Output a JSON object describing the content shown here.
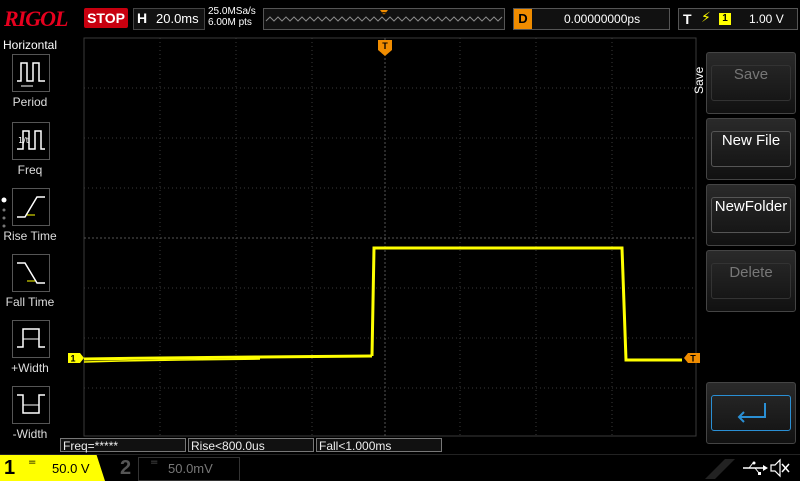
{
  "top": {
    "brand": "RIGOL",
    "run_state": "STOP",
    "horizontal_key": "H",
    "timebase": "20.0ms",
    "sample_rate": "25.0MSa/s",
    "memory_depth": "6.00M pts",
    "delay_key": "D",
    "delay_value": "0.00000000ps",
    "trigger_key": "T",
    "trigger_source": "1",
    "trigger_level": "1.00 V"
  },
  "left_panel": {
    "title": "Horizontal",
    "items": [
      {
        "label": "Period",
        "icon": "period-icon"
      },
      {
        "label": "Freq",
        "icon": "freq-icon"
      },
      {
        "label": "Rise Time",
        "icon": "rise-time-icon"
      },
      {
        "label": "Fall Time",
        "icon": "fall-time-icon"
      },
      {
        "label": "+Width",
        "icon": "positive-width-icon"
      },
      {
        "label": "-Width",
        "icon": "negative-width-icon"
      }
    ]
  },
  "right_menu": {
    "tab": "Save",
    "buttons": [
      {
        "label": "Save",
        "enabled": false
      },
      {
        "label": "New File",
        "enabled": true
      },
      {
        "label": "NewFolder",
        "enabled": true
      },
      {
        "label": "Delete",
        "enabled": false
      },
      {
        "label": "",
        "enabled": true,
        "icon": "enter-icon"
      }
    ]
  },
  "measurements": [
    "Freq=*****",
    "Rise<800.0us",
    "Fall<1.000ms"
  ],
  "channels": {
    "ch1": {
      "number": "1",
      "coupling": "=",
      "scale": "50.0 V"
    },
    "ch2": {
      "number": "2",
      "coupling": "=",
      "scale": "50.0mV"
    }
  },
  "markers": {
    "ch1_marker": "1",
    "trigger_marker": "T"
  },
  "colors": {
    "ch1": "#ffff00",
    "trigger": "#f08c00",
    "brand": "#e6001e",
    "stop": "#c8000f"
  }
}
